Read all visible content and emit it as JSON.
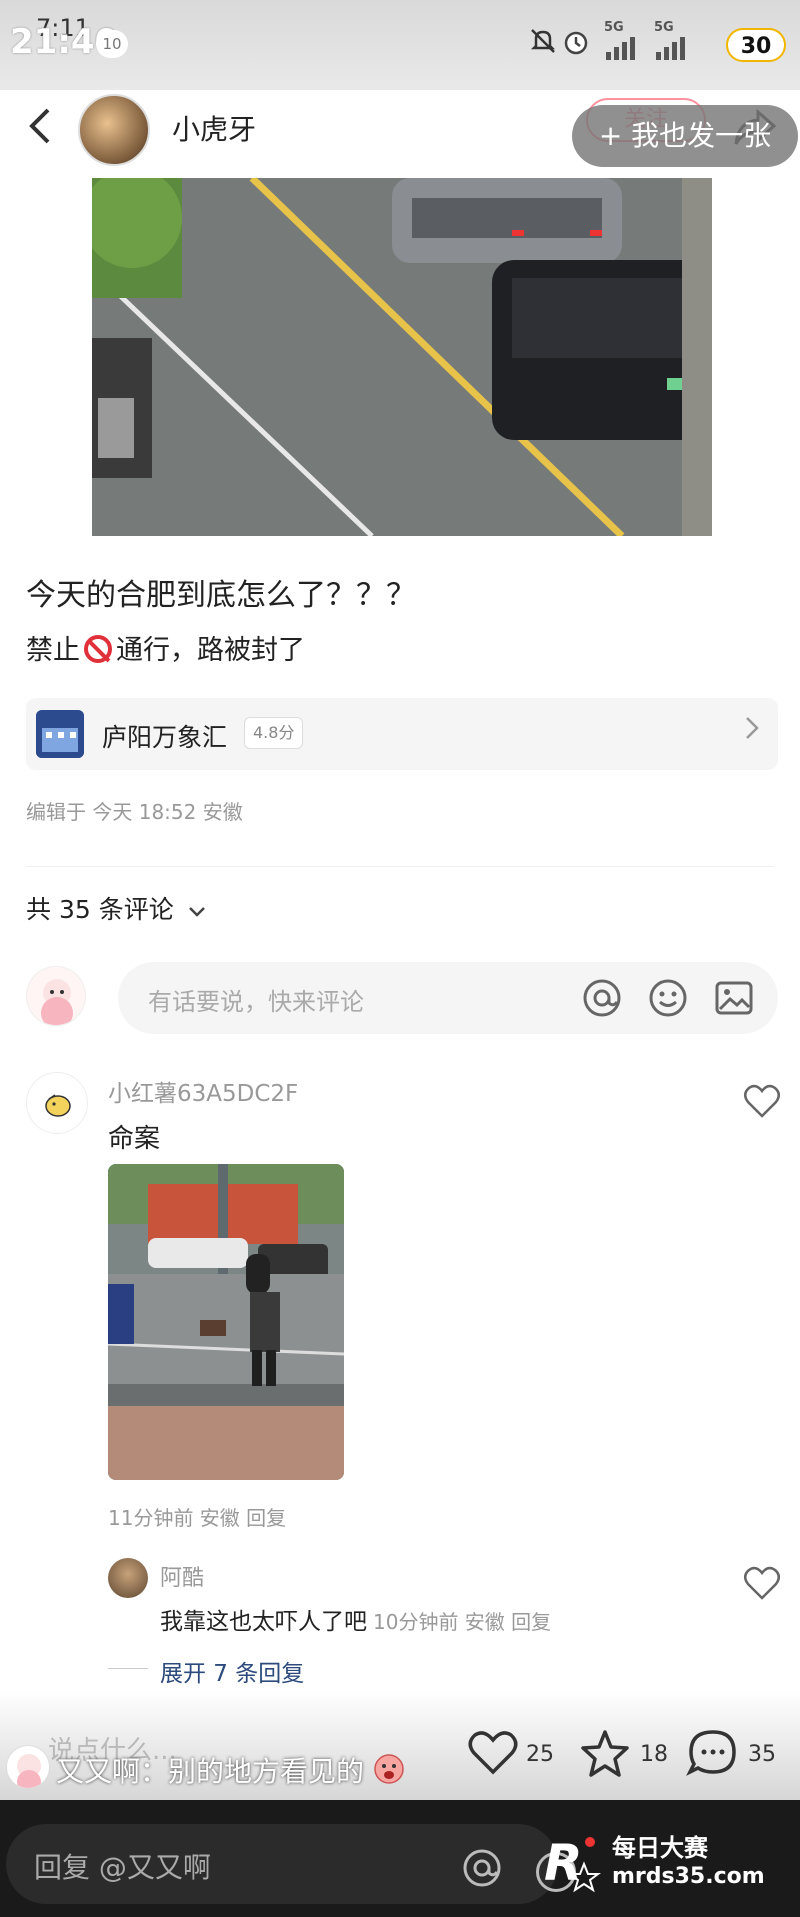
{
  "status_bar": {
    "time_overlay": "21:40",
    "time_underlay": "7:11",
    "notification_badge": "10",
    "battery": "30",
    "network_signal": "5G",
    "network_signal_2": "5G"
  },
  "header": {
    "back_icon": "chevron-left-icon",
    "author_name": "小虎牙",
    "follow_label": "关注",
    "share_icon": "share-icon",
    "post_also_label": "+ 我也发一张"
  },
  "post": {
    "title": "今天的合肥到底怎么了？？？",
    "body_before": "禁止",
    "body_after": "通行，路被封了",
    "location_name": "庐阳万象汇",
    "location_score": "4.8分",
    "edited_info": "编辑于 今天 18:52 安徽"
  },
  "comments_section": {
    "count_label": "共 35 条评论",
    "input_placeholder": "有话要说，快来评论",
    "input_icons": [
      "at-icon",
      "emoji-icon",
      "image-icon"
    ]
  },
  "comments": [
    {
      "author": "小红薯63A5DC2F",
      "text": "命案",
      "meta": "11分钟前 安徽 回复",
      "reply": {
        "author": "阿酷",
        "text": "我靠这也太吓人了吧",
        "meta": "10分钟前 安徽 回复"
      },
      "expand_label": "展开 7 条回复"
    }
  ],
  "bottom_bar": {
    "say_something": "说点什么...",
    "barrage_text": "又又啊：别的地方看见的",
    "likes": "25",
    "stars": "18",
    "comments": "35"
  },
  "reply_bar": {
    "placeholder": "回复 @又又啊"
  },
  "watermark": {
    "name": "每日大赛",
    "url": "mrds35.com"
  },
  "colors": {
    "accent": "#ff2442",
    "link": "#2c4b7c",
    "muted": "#999999"
  }
}
